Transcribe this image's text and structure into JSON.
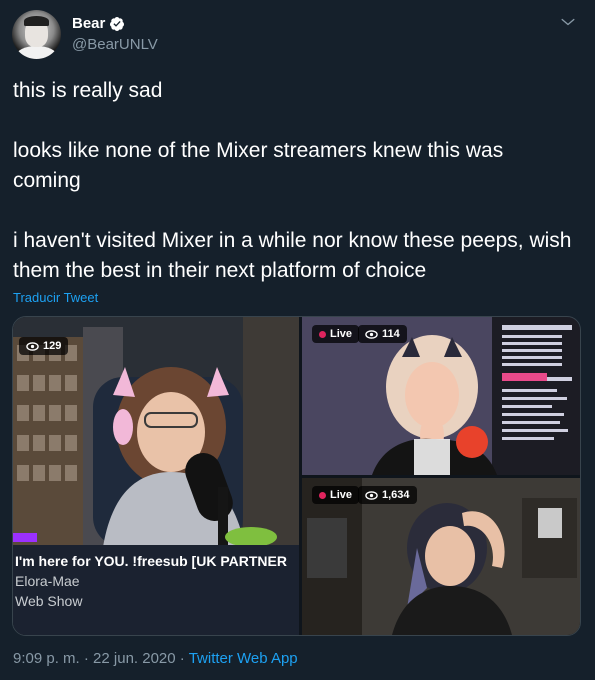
{
  "tweet": {
    "author_name": "Bear",
    "author_handle": "@BearUNLV",
    "lines": [
      "this is really sad",
      "looks like none of the Mixer streamers knew this was coming",
      "i haven't visited Mixer in a while nor know these peeps, wish them the best in their next platform of choice"
    ],
    "translate_label": "Traducir Tweet",
    "time": "9:09 p. m.",
    "date": "22 jun. 2020",
    "separator": "·",
    "source_app": "Twitter Web App"
  },
  "media": {
    "left_panel": {
      "viewers": "129",
      "caption_title": "I'm here for YOU. !freesub [UK PARTNER",
      "caption_streamer": "Elora-Mae",
      "caption_category": "Web Show"
    },
    "top_right_panel": {
      "live_label": "Live",
      "viewers": "114"
    },
    "bottom_right_panel": {
      "live_label": "Live",
      "viewers": "1,634"
    }
  },
  "icons": {
    "verified": "verified-badge-icon",
    "menu": "chevron-down-icon",
    "viewers": "eye-icon"
  },
  "colors": {
    "background": "#15202b",
    "accent": "#1da1f2",
    "secondary_text": "#8899a6",
    "live": "#e0245e"
  }
}
